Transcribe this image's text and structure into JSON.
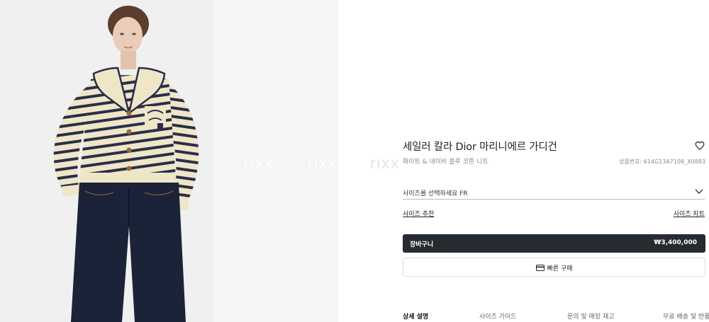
{
  "watermark": [
    "rixx",
    "rixx",
    "rixx"
  ],
  "product": {
    "title": "세일러 칼라 Dior 마리니에르 가디건",
    "subtitle": "화이트 & 네이비 블루 코튼 니트",
    "sku": "상품번호: 614G13A7108_X0883"
  },
  "size": {
    "select_label": "사이즈를 선택하세요 FR",
    "recommend_link": "사이즈 추천",
    "chart_link": "사이즈 차트"
  },
  "cart": {
    "label": "장바구니",
    "price": "₩3,400,000"
  },
  "quick_buy": {
    "label": "빠른 구매"
  },
  "tabs": [
    {
      "label": "상세 설명",
      "active": true
    },
    {
      "label": "사이즈 가이드",
      "active": false
    },
    {
      "label": "문의 및 매장 재고",
      "active": false
    },
    {
      "label": "무료 배송 및 반품",
      "active": false
    }
  ],
  "icons": {
    "wishlist": "heart-icon",
    "size_dropdown": "chevron-down-icon",
    "quick_buy": "credit-card-icon"
  },
  "colors": {
    "cart_button": "#262a31",
    "image_background": "#f0f0f0",
    "cardigan_cream": "#efe6c8",
    "stripe_navy": "#2a2e48",
    "jeans": "#1b2338"
  }
}
